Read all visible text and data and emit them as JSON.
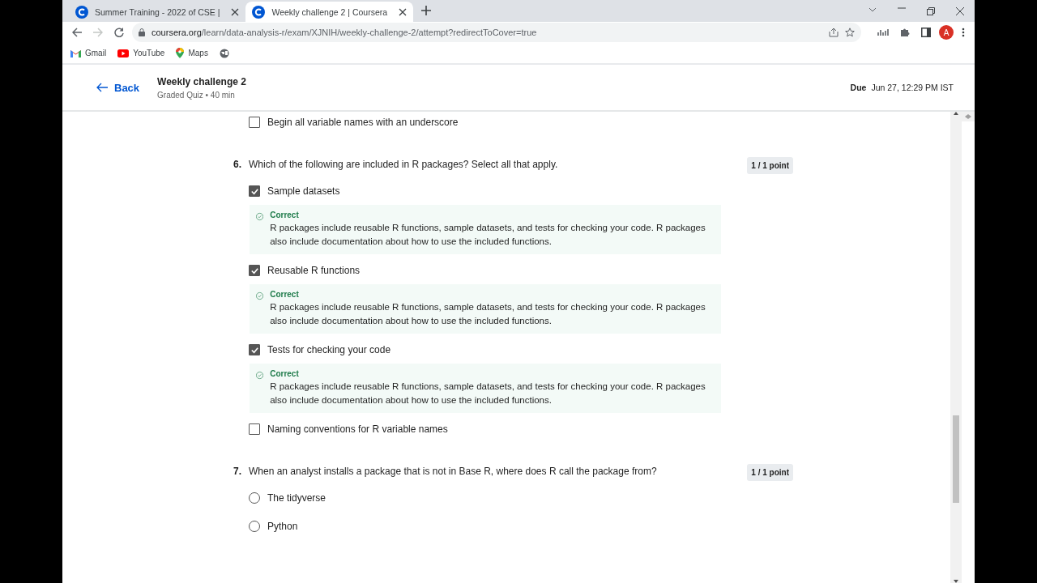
{
  "browser": {
    "tabs": [
      {
        "title": "Summer Training - 2022 of CSE |",
        "selected": false
      },
      {
        "title": "Weekly challenge 2 | Coursera",
        "selected": true
      }
    ],
    "address": {
      "domain": "coursera.org",
      "path": "/learn/data-analysis-r/exam/XJNIH/weekly-challenge-2/attempt?redirectToCover=true"
    },
    "profile_initial": "A",
    "bookmarks": [
      {
        "kind": "gmail",
        "label": "Gmail"
      },
      {
        "kind": "youtube",
        "label": "YouTube"
      },
      {
        "kind": "maps",
        "label": "Maps"
      },
      {
        "kind": "globe"
      }
    ]
  },
  "header": {
    "back": "Back",
    "title": "Weekly challenge 2",
    "subtitle": "Graded Quiz • 40 min",
    "due_label": "Due",
    "due_date": "Jun 27, 12:29 PM IST"
  },
  "cut_option": {
    "label": "Begin all variable names with an underscore",
    "checked": false
  },
  "questions": [
    {
      "number": "6.",
      "kind": "checkbox",
      "text": "Which of the following are included in R packages? Select all that apply.",
      "points": "1 / 1 point",
      "options": [
        {
          "label": "Sample datasets",
          "checked": true,
          "feedback": {
            "status": "Correct",
            "text": "R packages include reusable R functions, sample datasets, and tests for checking your code. R packages also include documentation about how to use the included functions."
          }
        },
        {
          "label": "Reusable R functions",
          "checked": true,
          "feedback": {
            "status": "Correct",
            "text": "R packages include reusable R functions, sample datasets, and tests for checking your code. R packages also include documentation about how to use the included functions."
          }
        },
        {
          "label": "Tests for checking your code",
          "checked": true,
          "feedback": {
            "status": "Correct",
            "text": "R packages include reusable R functions, sample datasets, and tests for checking your code. R packages also include documentation about how to use the included functions."
          }
        },
        {
          "label": "Naming conventions for R variable names",
          "checked": false
        }
      ]
    },
    {
      "number": "7.",
      "kind": "radio",
      "text": "When an analyst installs a package that is not in Base R, where does R call the package from?",
      "points": "1 / 1 point",
      "options": [
        {
          "label": "The tidyverse",
          "selected": false
        },
        {
          "label": "Python",
          "selected": false
        }
      ]
    }
  ]
}
